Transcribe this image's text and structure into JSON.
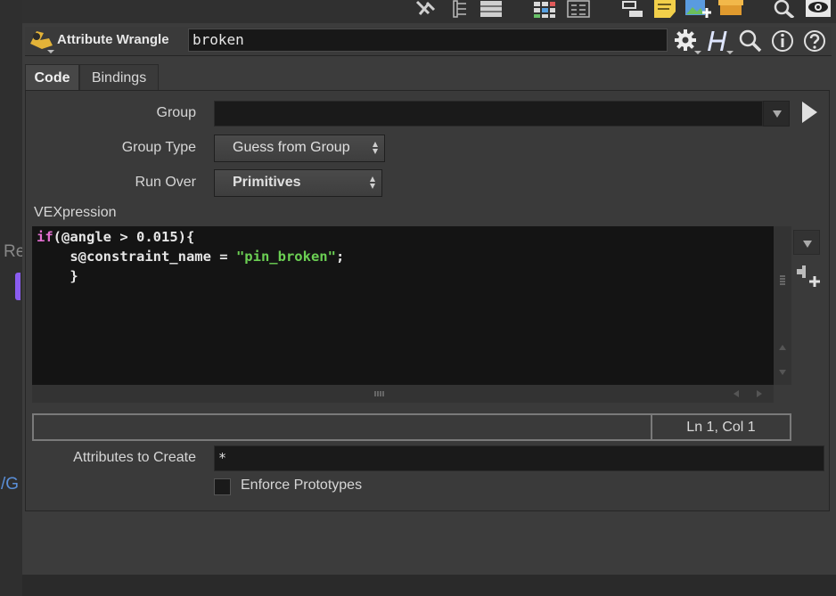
{
  "header": {
    "node_type": "Attribute Wrangle",
    "node_name": "broken"
  },
  "tabs": [
    {
      "label": "Code",
      "active": true
    },
    {
      "label": "Bindings",
      "active": false
    }
  ],
  "params": {
    "group": {
      "label": "Group",
      "value": ""
    },
    "group_type": {
      "label": "Group Type",
      "value": "Guess from Group"
    },
    "run_over": {
      "label": "Run Over",
      "value": "Primitives"
    },
    "vexpression": {
      "label": "VEXpression",
      "lines": [
        {
          "kw": "if",
          "rest": "(@angle > 0.015){"
        },
        {
          "indent": "    ",
          "pre": "s@constraint_name = ",
          "str": "\"pin_broken\"",
          "post": ";"
        },
        {
          "indent": "    ",
          "pre": "}"
        }
      ]
    },
    "status": {
      "position": "Ln 1, Col 1"
    },
    "attributes_to_create": {
      "label": "Attributes to Create",
      "value": "*"
    },
    "enforce_prototypes": {
      "label": "Enforce Prototypes",
      "checked": false
    }
  },
  "background_fragments": {
    "left_a": "Re",
    "left_b": "/G"
  },
  "colors": {
    "keyword": "#e36ed1",
    "string": "#6bcf53",
    "code_bg": "#141414",
    "panel_bg": "#3a3a3a"
  },
  "icons": {
    "toolbar": [
      "tools-icon",
      "tree-view-icon",
      "list-view-icon",
      "grid-view-icon",
      "details-view-icon",
      "network-layout-icon",
      "sticky-note-icon",
      "add-image-icon",
      "package-icon",
      "search-icon",
      "visibility-eye-icon"
    ],
    "header": [
      "wrangle-node-icon",
      "gear-icon",
      "houdini-help-icon",
      "zoom-icon",
      "info-icon",
      "help-icon"
    ]
  }
}
